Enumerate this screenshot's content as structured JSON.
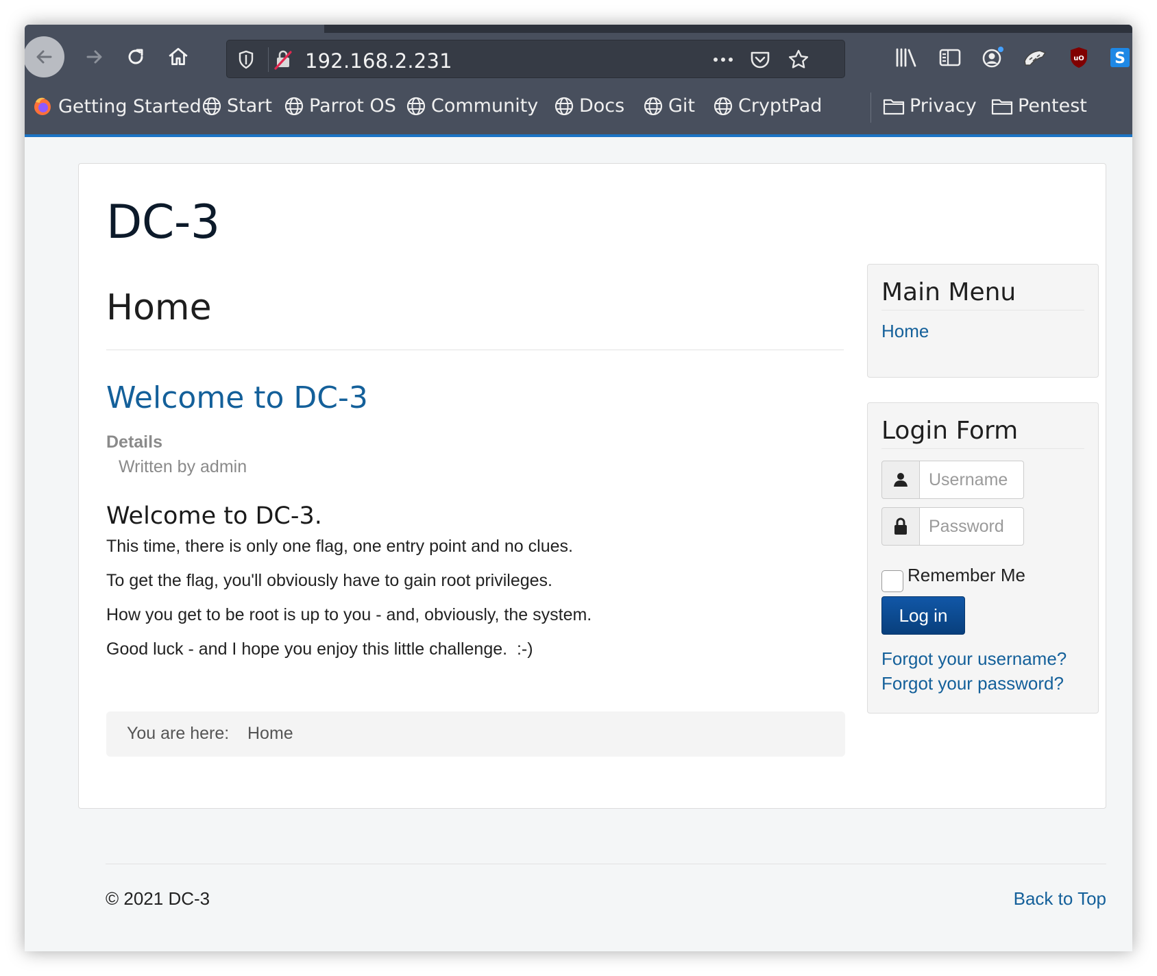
{
  "browser": {
    "url": "192.168.2.231",
    "bookmarks": [
      {
        "label": "Getting Started",
        "icon": "firefox-icon"
      },
      {
        "label": "Start",
        "icon": "globe-icon"
      },
      {
        "label": "Parrot OS",
        "icon": "globe-icon"
      },
      {
        "label": "Community",
        "icon": "globe-icon"
      },
      {
        "label": "Docs",
        "icon": "globe-icon"
      },
      {
        "label": "Git",
        "icon": "globe-icon"
      },
      {
        "label": "CryptPad",
        "icon": "globe-icon"
      },
      {
        "label": "Privacy",
        "icon": "folder-icon"
      },
      {
        "label": "Pentest",
        "icon": "folder-icon"
      }
    ]
  },
  "site": {
    "title": "DC-3"
  },
  "content": {
    "page_heading": "Home",
    "article_title": "Welcome to DC-3",
    "details_label": "Details",
    "written_by": "Written by admin",
    "lead": "Welcome to DC-3.",
    "paragraphs": [
      "This time, there is only one flag, one entry point and no clues.",
      "To get the flag, you'll obviously have to gain root privileges.",
      "How you get to be root is up to you - and, obviously, the system.",
      "Good luck - and I hope you enjoy this little challenge.  :-)"
    ]
  },
  "breadcrumb": {
    "label": "You are here:",
    "item": "Home"
  },
  "main_menu": {
    "title": "Main Menu",
    "items": [
      "Home"
    ]
  },
  "login_form": {
    "title": "Login Form",
    "username_placeholder": "Username",
    "password_placeholder": "Password",
    "remember_label": "Remember Me",
    "login_button": "Log in",
    "forgot_username": "Forgot your username?",
    "forgot_password": "Forgot your password?"
  },
  "footer": {
    "copyright": "© 2021 DC-3",
    "back_to_top": "Back to Top"
  },
  "colors": {
    "link": "#14609a",
    "chrome": "#484f5d",
    "accent": "#1b74c5",
    "login_button": "#0b4f95"
  }
}
